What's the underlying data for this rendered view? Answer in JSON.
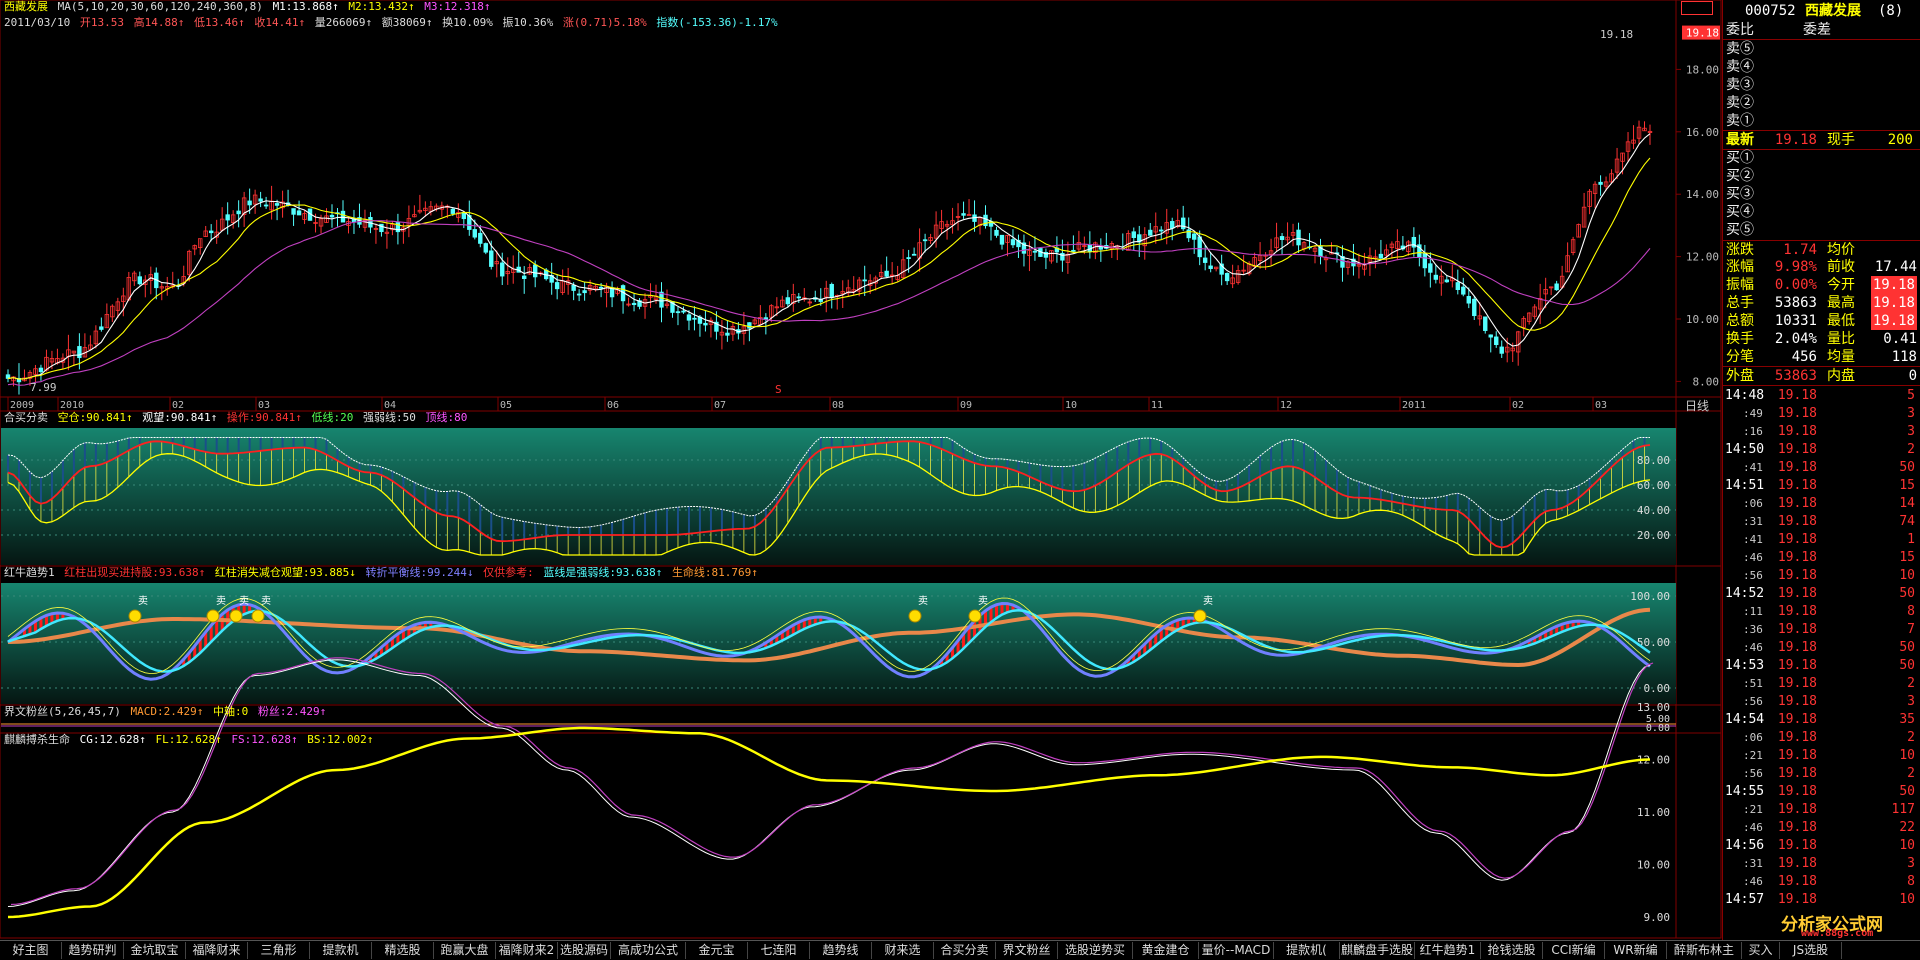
{
  "header": {
    "stock_name": "西藏发展",
    "ma_params": "MA(5,10,20,30,60,120,240,360,8)",
    "m1": "M1:13.868↑",
    "m2": "M2:13.432↑",
    "m3": "M3:12.318↑",
    "date": "2011/03/10",
    "open": "开13.53",
    "high": "高14.88↑",
    "low": "低13.46↑",
    "close": "收14.41↑",
    "volume": "量266069↑",
    "amount": "额38069↑",
    "turnover": "换10.09%",
    "amplitude": "振10.36%",
    "change": "涨(0.71)5.18%",
    "index": "指数(-153.36)-1.17%",
    "peak_label": "19.18",
    "low_label": "7.99",
    "mark_s": "S"
  },
  "price_axis": {
    "ticks": [
      "18.00",
      "16.00",
      "14.00",
      "12.00",
      "10.00",
      "8.00"
    ],
    "current": "19.18"
  },
  "time_axis": {
    "labels": [
      "2009",
      "2010",
      "02",
      "03",
      "04",
      "05",
      "06",
      "07",
      "08",
      "09",
      "10",
      "11",
      "12",
      "2011",
      "02",
      "03"
    ],
    "period": "日线"
  },
  "panel1": {
    "title": "合买分卖",
    "items": [
      "空仓:90.841↑",
      "观望:90.841↑",
      "操作:90.841↑",
      "低线:20",
      "强弱线:50",
      "顶线:80"
    ],
    "ticks": [
      "80.00",
      "60.00",
      "40.00",
      "20.00"
    ]
  },
  "panel2": {
    "title": "红牛趋势1",
    "items": [
      "红柱出现买进持股:93.638↑",
      "红柱消失减仓观望:93.885↓",
      "转折平衡线:99.244↓",
      "仅供参考:",
      "蓝线是强弱线:93.638↑",
      "生命线:81.769↑"
    ],
    "ticks": [
      "100.00",
      "50.00",
      "0.00"
    ],
    "sell_mark": "卖"
  },
  "panel3": {
    "title": "界文粉丝(5,26,45,7)",
    "items": [
      "MACD:2.429↑",
      "中轴:0",
      "粉丝:2.429↑"
    ],
    "ticks": [
      "5.00",
      "0.00"
    ]
  },
  "panel4": {
    "title": "麒麟搏杀生命",
    "items": [
      "CG:12.628↑",
      "FL:12.628↑",
      "FS:12.628↑",
      "BS:12.002↑"
    ],
    "ticks": [
      "13.00",
      "12.00",
      "11.00",
      "10.00",
      "9.00"
    ]
  },
  "quote": {
    "code": "000752",
    "name": "西藏发展",
    "suffix": "(8)",
    "weibi": "委比",
    "weicha": "委差",
    "sells": [
      "卖⑤",
      "卖④",
      "卖③",
      "卖②",
      "卖①"
    ],
    "buys": [
      "买①",
      "买②",
      "买③",
      "买④",
      "买⑤"
    ],
    "latest_label": "最新",
    "latest": "19.18",
    "xianshou_label": "现手",
    "xianshou": "200",
    "stats": [
      {
        "l": "涨跌",
        "v": "1.74",
        "l2": "均价",
        "v2": ""
      },
      {
        "l": "涨幅",
        "v": "9.98%",
        "l2": "前收",
        "v2": "17.44"
      },
      {
        "l": "振幅",
        "v": "0.00%",
        "l2": "今开",
        "v2": "19.18"
      },
      {
        "l": "总手",
        "v": "53863",
        "l2": "最高",
        "v2": "19.18"
      },
      {
        "l": "总额",
        "v": "10331",
        "l2": "最低",
        "v2": "19.18"
      },
      {
        "l": "换手",
        "v": "2.04%",
        "l2": "量比",
        "v2": "0.41"
      },
      {
        "l": "分笔",
        "v": "456",
        "l2": "均量",
        "v2": "118"
      },
      {
        "l": "外盘",
        "v": "53863",
        "l2": "内盘",
        "v2": "0"
      }
    ],
    "ticks": [
      [
        "14:48",
        "19.18",
        "5"
      ],
      [
        ":49",
        "19.18",
        "3"
      ],
      [
        ":16",
        "19.18",
        "3"
      ],
      [
        "14:50",
        "19.18",
        "2"
      ],
      [
        ":41",
        "19.18",
        "50"
      ],
      [
        "14:51",
        "19.18",
        "15"
      ],
      [
        ":06",
        "19.18",
        "14"
      ],
      [
        ":31",
        "19.18",
        "74"
      ],
      [
        ":41",
        "19.18",
        "1"
      ],
      [
        ":46",
        "19.18",
        "15"
      ],
      [
        ":56",
        "19.18",
        "10"
      ],
      [
        "14:52",
        "19.18",
        "50"
      ],
      [
        ":11",
        "19.18",
        "8"
      ],
      [
        ":36",
        "19.18",
        "7"
      ],
      [
        ":46",
        "19.18",
        "50"
      ],
      [
        "14:53",
        "19.18",
        "50"
      ],
      [
        ":51",
        "19.18",
        "2"
      ],
      [
        ":56",
        "19.18",
        "3"
      ],
      [
        "14:54",
        "19.18",
        "35"
      ],
      [
        ":06",
        "19.18",
        "2"
      ],
      [
        ":21",
        "19.18",
        "10"
      ],
      [
        ":56",
        "19.18",
        "2"
      ],
      [
        "14:55",
        "19.18",
        "50"
      ],
      [
        ":21",
        "19.18",
        "117"
      ],
      [
        ":46",
        "19.18",
        "22"
      ],
      [
        "14:56",
        "19.18",
        "10"
      ],
      [
        ":31",
        "19.18",
        "3"
      ],
      [
        ":46",
        "19.18",
        "8"
      ],
      [
        "14:57",
        "19.18",
        "10"
      ]
    ],
    "watermark": "分析家公式网",
    "watermark_url": "www.88gs.com"
  },
  "tabs": [
    "好主图",
    "趋势研判",
    "金坑取宝",
    "福降财来",
    "三角形",
    "提款机",
    "精选股",
    "跑赢大盘",
    "福降财来2",
    "选股源码",
    "高成功公式",
    "金元宝",
    "七连阳",
    "趋势线",
    "财来选",
    "合买分卖",
    "界文粉丝",
    "选股逆势买",
    "黄金建仓",
    "量价--MACD",
    "提款机(",
    "麒麟盘手选股",
    "红牛趋势1",
    "抢钱选股",
    "CCI新编",
    "WR新编",
    "醉斯布林主",
    "买入",
    "JS选股"
  ],
  "colors": {
    "up": "#ff3333",
    "down": "#54ffff",
    "border": "#800000",
    "yellow": "#ffff00",
    "magenta": "#c040c0"
  }
}
